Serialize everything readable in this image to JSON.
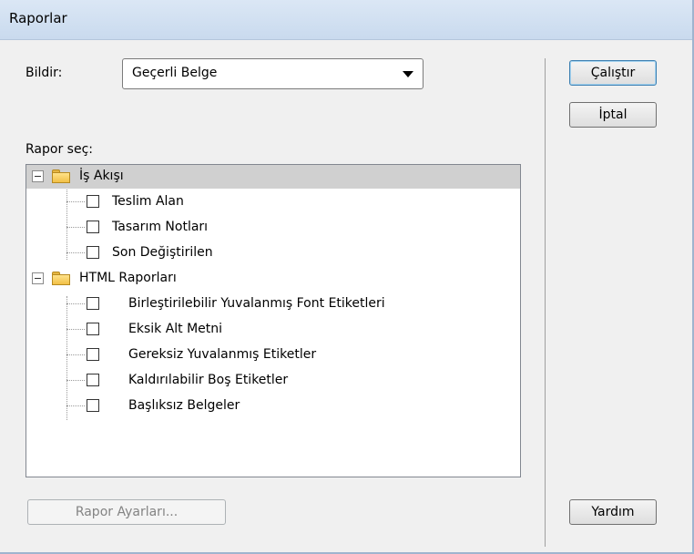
{
  "window": {
    "title": "Raporlar"
  },
  "report_on": {
    "label": "Bildir:",
    "selected": "Geçerli Belge"
  },
  "select_report": {
    "label": "Rapor seç:",
    "groups": [
      {
        "name": "İş Akışı",
        "items": [
          "Teslim Alan",
          "Tasarım Notları",
          "Son Değiştirilen"
        ]
      },
      {
        "name": "HTML Raporları",
        "items": [
          "Birleştirilebilir Yuvalanmış Font Etiketleri",
          "Eksik Alt Metni",
          "Gereksiz Yuvalanmış Etiketler",
          "Kaldırılabilir Boş Etiketler",
          "Başlıksız Belgeler"
        ]
      }
    ]
  },
  "buttons": {
    "run": "Çalıştır",
    "cancel": "İptal",
    "report_settings": "Rapor Ayarları...",
    "help": "Yardım"
  }
}
